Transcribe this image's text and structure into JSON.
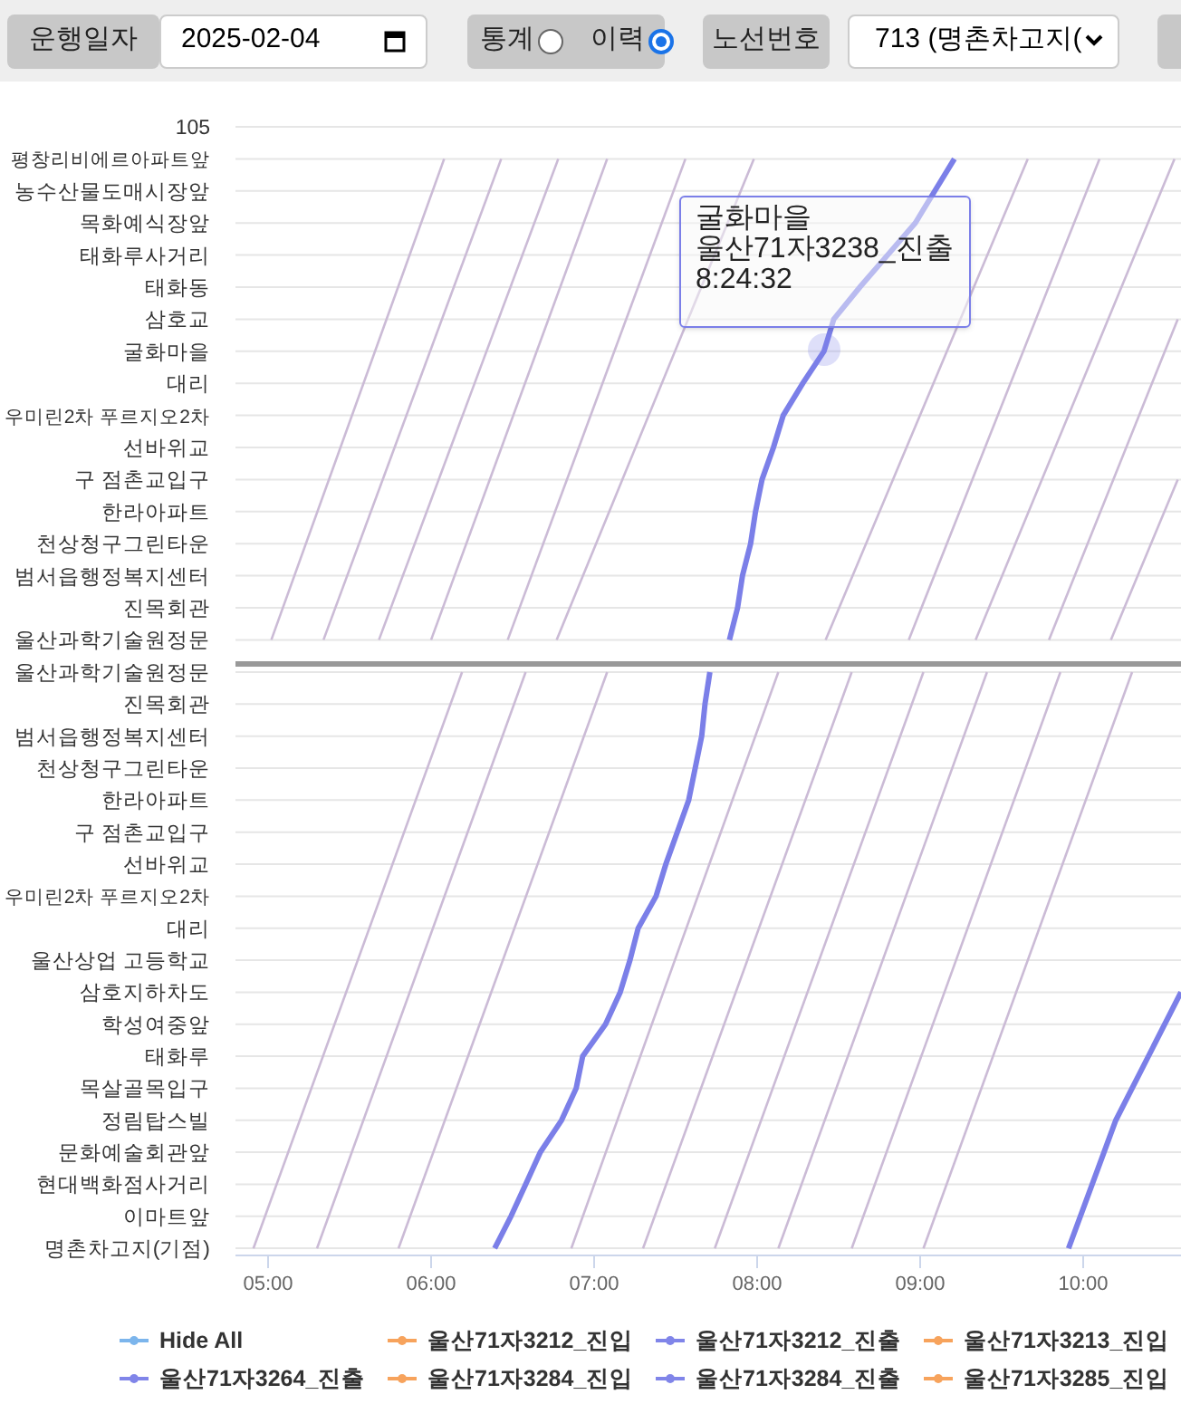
{
  "toolbar": {
    "date_label": "운행일자",
    "date": "2025-02-04",
    "mode_options": [
      {
        "label": "통계",
        "selected": false
      },
      {
        "label": "이력",
        "selected": true
      }
    ],
    "route_label": "노선번호",
    "route": "713 (명촌차고지("
  },
  "chart": {
    "chart_data": {
      "type": "line",
      "orientation": "horizontal",
      "grid": true,
      "categories": [
        "105",
        "평창리비에르아파트앞",
        "농수산물도매시장앞",
        "목화예식장앞",
        "태화루사거리",
        "태화동",
        "삼호교",
        "굴화마을",
        "대리",
        "우미린2차 푸르지오2차",
        "선바위교",
        "구 점촌교입구",
        "한라아파트",
        "천상청구그린타운",
        "범서읍행정복지센터",
        "진목회관",
        "울산과학기술원정문",
        "울산과학기술원정문",
        "진목회관",
        "범서읍행정복지센터",
        "천상청구그린타운",
        "한라아파트",
        "구 점촌교입구",
        "선바위교",
        "우미린2차 푸르지오2차",
        "대리",
        "울산상업 고등학교",
        "삼호지하차도",
        "학성여중앞",
        "태화루",
        "목살골목입구",
        "정림탑스빌",
        "문화예술회관앞",
        "현대백화점사거리",
        "이마트앞",
        "명촌차고지(기점)"
      ],
      "xlim": [
        4.8,
        10.6
      ],
      "xticks": [
        {
          "value": 5,
          "label": "05:00"
        },
        {
          "value": 6,
          "label": "06:00"
        },
        {
          "value": 7,
          "label": "07:00"
        },
        {
          "value": 8,
          "label": "08:00"
        },
        {
          "value": 9,
          "label": "09:00"
        },
        {
          "value": 10,
          "label": "10:00"
        }
      ],
      "series": [
        {
          "color": "#7b7fe8",
          "values": [
            null,
            9.21,
            9.09,
            8.97,
            8.8,
            8.63,
            8.47,
            8.41,
            8.28,
            8.16,
            8.1,
            8.03,
            7.99,
            7.96,
            7.91,
            7.88,
            7.83,
            7.71,
            7.68,
            7.66,
            7.62,
            7.58,
            7.51,
            7.44,
            7.38,
            7.27,
            7.22,
            7.16,
            7.07,
            6.93,
            6.89,
            6.8,
            6.67,
            6.58,
            6.49,
            6.39
          ]
        },
        {
          "color": "#7b7fe8",
          "values": [
            null,
            null,
            null,
            null,
            null,
            null,
            null,
            null,
            null,
            null,
            null,
            null,
            null,
            null,
            null,
            null,
            null,
            null,
            null,
            null,
            null,
            null,
            null,
            null,
            null,
            null,
            null,
            10.6,
            null,
            null,
            null,
            10.2,
            null,
            null,
            null,
            9.91
          ]
        },
        {
          "color": "#cbbbd6",
          "values": [
            null,
            6.08,
            null,
            null,
            null,
            null,
            null,
            null,
            null,
            null,
            null,
            null,
            null,
            null,
            null,
            null,
            5.02,
            null,
            null,
            null,
            null,
            null,
            null,
            null,
            null,
            null,
            null,
            null,
            null,
            null,
            null,
            null,
            null,
            null,
            null,
            null
          ]
        },
        {
          "color": "#cbbbd6",
          "values": [
            null,
            6.43,
            null,
            null,
            null,
            null,
            null,
            null,
            null,
            null,
            null,
            null,
            null,
            null,
            null,
            null,
            5.34,
            null,
            null,
            null,
            null,
            null,
            null,
            null,
            null,
            null,
            null,
            null,
            null,
            null,
            null,
            null,
            null,
            null,
            null,
            null
          ]
        },
        {
          "color": "#cbbbd6",
          "values": [
            null,
            6.78,
            null,
            null,
            null,
            null,
            null,
            null,
            null,
            null,
            null,
            null,
            null,
            null,
            null,
            null,
            5.68,
            null,
            null,
            null,
            null,
            null,
            null,
            null,
            null,
            null,
            null,
            null,
            null,
            null,
            null,
            null,
            null,
            null,
            null,
            null
          ]
        },
        {
          "color": "#cbbbd6",
          "values": [
            null,
            7.08,
            null,
            null,
            null,
            null,
            null,
            null,
            null,
            null,
            null,
            null,
            null,
            null,
            null,
            null,
            6.0,
            null,
            null,
            null,
            null,
            null,
            null,
            null,
            null,
            null,
            null,
            null,
            null,
            null,
            null,
            null,
            null,
            null,
            null,
            null
          ]
        },
        {
          "color": "#cbbbd6",
          "values": [
            null,
            7.56,
            null,
            null,
            null,
            null,
            null,
            null,
            null,
            null,
            null,
            null,
            null,
            null,
            null,
            null,
            6.47,
            null,
            null,
            null,
            null,
            null,
            null,
            null,
            null,
            null,
            null,
            null,
            null,
            null,
            null,
            null,
            null,
            null,
            null,
            null
          ]
        },
        {
          "color": "#cbbbd6",
          "values": [
            null,
            7.98,
            null,
            null,
            null,
            null,
            null,
            null,
            null,
            null,
            null,
            null,
            null,
            null,
            null,
            null,
            6.77,
            null,
            null,
            null,
            null,
            null,
            null,
            null,
            null,
            null,
            null,
            null,
            null,
            null,
            null,
            null,
            null,
            null,
            null,
            null
          ]
        },
        {
          "color": "#cbbbd6",
          "values": [
            null,
            9.66,
            null,
            null,
            null,
            null,
            null,
            null,
            null,
            null,
            null,
            null,
            null,
            null,
            null,
            null,
            8.42,
            null,
            null,
            null,
            null,
            null,
            null,
            null,
            null,
            null,
            null,
            null,
            null,
            null,
            null,
            null,
            null,
            null,
            null,
            null
          ]
        },
        {
          "color": "#cbbbd6",
          "values": [
            null,
            10.1,
            null,
            null,
            null,
            null,
            null,
            null,
            null,
            null,
            null,
            null,
            null,
            null,
            null,
            null,
            8.93,
            null,
            null,
            null,
            null,
            null,
            null,
            null,
            null,
            null,
            null,
            null,
            null,
            null,
            null,
            null,
            null,
            null,
            null,
            null
          ]
        },
        {
          "color": "#cbbbd6",
          "values": [
            null,
            10.56,
            null,
            null,
            null,
            null,
            null,
            null,
            null,
            null,
            null,
            null,
            null,
            null,
            null,
            null,
            9.34,
            null,
            null,
            null,
            null,
            null,
            null,
            null,
            null,
            null,
            null,
            null,
            null,
            null,
            null,
            null,
            null,
            null,
            null,
            null
          ]
        },
        {
          "color": "#cbbbd6",
          "values": [
            null,
            null,
            null,
            null,
            null,
            null,
            10.58,
            null,
            null,
            null,
            null,
            null,
            null,
            null,
            null,
            null,
            9.79,
            null,
            null,
            null,
            null,
            null,
            null,
            null,
            null,
            null,
            null,
            null,
            null,
            null,
            null,
            null,
            null,
            null,
            null,
            null
          ]
        },
        {
          "color": "#cbbbd6",
          "values": [
            null,
            null,
            null,
            null,
            null,
            null,
            null,
            null,
            null,
            null,
            null,
            10.58,
            null,
            null,
            null,
            null,
            10.17,
            null,
            null,
            null,
            null,
            null,
            null,
            null,
            null,
            null,
            null,
            null,
            null,
            null,
            null,
            null,
            null,
            null,
            null,
            null
          ]
        },
        {
          "color": "#cbbbd6",
          "values": [
            null,
            null,
            null,
            null,
            null,
            null,
            null,
            null,
            null,
            null,
            null,
            null,
            null,
            null,
            null,
            null,
            null,
            6.19,
            null,
            null,
            null,
            null,
            null,
            null,
            null,
            null,
            null,
            null,
            null,
            null,
            null,
            null,
            null,
            null,
            null,
            4.91
          ]
        },
        {
          "color": "#cbbbd6",
          "values": [
            null,
            null,
            null,
            null,
            null,
            null,
            null,
            null,
            null,
            null,
            null,
            null,
            null,
            null,
            null,
            null,
            null,
            6.58,
            null,
            null,
            null,
            null,
            null,
            null,
            null,
            null,
            null,
            null,
            null,
            null,
            null,
            null,
            null,
            null,
            null,
            5.3
          ]
        },
        {
          "color": "#cbbbd6",
          "values": [
            null,
            null,
            null,
            null,
            null,
            null,
            null,
            null,
            null,
            null,
            null,
            null,
            null,
            null,
            null,
            null,
            null,
            7.08,
            null,
            null,
            null,
            null,
            null,
            null,
            null,
            null,
            null,
            null,
            null,
            null,
            null,
            null,
            null,
            null,
            null,
            5.8
          ]
        },
        {
          "color": "#cbbbd6",
          "values": [
            null,
            null,
            null,
            null,
            null,
            null,
            null,
            null,
            null,
            null,
            null,
            null,
            null,
            null,
            null,
            null,
            null,
            8.13,
            null,
            null,
            null,
            null,
            null,
            null,
            null,
            null,
            null,
            null,
            null,
            null,
            null,
            null,
            null,
            null,
            null,
            6.86
          ]
        },
        {
          "color": "#cbbbd6",
          "values": [
            null,
            null,
            null,
            null,
            null,
            null,
            null,
            null,
            null,
            null,
            null,
            null,
            null,
            null,
            null,
            null,
            null,
            8.58,
            null,
            null,
            null,
            null,
            null,
            null,
            null,
            null,
            null,
            null,
            null,
            null,
            null,
            null,
            null,
            null,
            null,
            7.3
          ]
        },
        {
          "color": "#cbbbd6",
          "values": [
            null,
            null,
            null,
            null,
            null,
            null,
            null,
            null,
            null,
            null,
            null,
            null,
            null,
            null,
            null,
            null,
            null,
            9.02,
            null,
            null,
            null,
            null,
            null,
            null,
            null,
            null,
            null,
            null,
            null,
            null,
            null,
            null,
            null,
            null,
            null,
            7.74
          ]
        },
        {
          "color": "#cbbbd6",
          "values": [
            null,
            null,
            null,
            null,
            null,
            null,
            null,
            null,
            null,
            null,
            null,
            null,
            null,
            null,
            null,
            null,
            null,
            9.41,
            null,
            null,
            null,
            null,
            null,
            null,
            null,
            null,
            null,
            null,
            null,
            null,
            null,
            null,
            null,
            null,
            null,
            8.13
          ]
        },
        {
          "color": "#cbbbd6",
          "values": [
            null,
            null,
            null,
            null,
            null,
            null,
            null,
            null,
            null,
            null,
            null,
            null,
            null,
            null,
            null,
            null,
            null,
            9.86,
            null,
            null,
            null,
            null,
            null,
            null,
            null,
            null,
            null,
            null,
            null,
            null,
            null,
            null,
            null,
            null,
            null,
            8.58
          ]
        },
        {
          "color": "#cbbbd6",
          "values": [
            null,
            null,
            null,
            null,
            null,
            null,
            null,
            null,
            null,
            null,
            null,
            null,
            null,
            null,
            null,
            null,
            null,
            10.3,
            null,
            null,
            null,
            null,
            null,
            null,
            null,
            null,
            null,
            null,
            null,
            null,
            null,
            null,
            null,
            null,
            null,
            9.02
          ]
        }
      ]
    },
    "tooltip": {
      "lines": [
        "굴화마을",
        "울산71자3238_진출",
        "8:24:32"
      ]
    }
  },
  "legend": {
    "items": [
      {
        "label": "Hide All",
        "color": "#7cb5ec"
      },
      {
        "label": "울산71자3212_진입",
        "color": "#f7a35c"
      },
      {
        "label": "울산71자3212_진출",
        "color": "#8085e9"
      },
      {
        "label": "울산71자3213_진입",
        "color": "#f7a35c"
      },
      {
        "label": "울산71자3264_진출",
        "color": "#8085e9"
      },
      {
        "label": "울산71자3284_진입",
        "color": "#f7a35c"
      },
      {
        "label": "울산71자3284_진출",
        "color": "#8085e9"
      },
      {
        "label": "울산71자3285_진입",
        "color": "#f7a35c"
      }
    ]
  }
}
